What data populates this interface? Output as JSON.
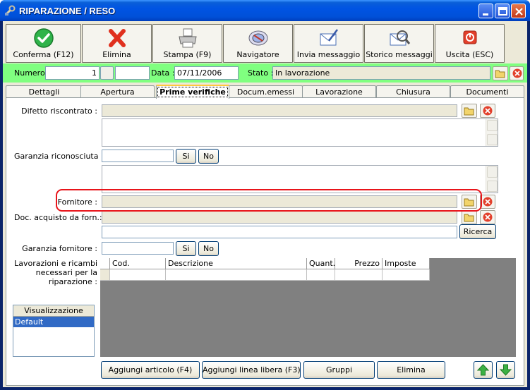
{
  "window": {
    "title": "RIPARAZIONE / RESO"
  },
  "toolbar": {
    "buttons": [
      {
        "label": "Conferma (F12)",
        "icon": "check-icon"
      },
      {
        "label": "Elimina",
        "icon": "delete-x-icon"
      },
      {
        "label": "Stampa (F9)",
        "icon": "printer-icon"
      },
      {
        "label": "Navigatore",
        "icon": "compass-icon"
      },
      {
        "label": "Invia messaggio",
        "icon": "send-mail-icon"
      },
      {
        "label": "Storico messaggi",
        "icon": "mail-history-icon"
      },
      {
        "label": "Uscita (ESC)",
        "icon": "exit-icon"
      }
    ]
  },
  "header": {
    "numero_label": "Numero :",
    "numero_value": "1",
    "data_label": "Data :",
    "data_value": "07/11/2006",
    "stato_label": "Stato :",
    "stato_value": "In lavorazione",
    "background_color": "#80ff80"
  },
  "tabs": [
    "Dettagli",
    "Apertura",
    "Prime verifiche",
    "Docum.emessi",
    "Lavorazione",
    "Chiusura",
    "Documenti"
  ],
  "active_tab": "Prime verifiche",
  "form": {
    "difetto_label": "Difetto riscontrato :",
    "garanzia_label": "Garanzia riconosciuta :",
    "si_label": "Si",
    "no_label": "No",
    "fornitore_label": "Fornitore :",
    "doc_acquisto_label": "Doc. acquisto da forn.:",
    "ricerca_label": "Ricerca",
    "garanzia_fornitore_label": "Garanzia fornitore :",
    "lavorazioni_label": "Lavorazioni e ricambi necessari per la riparazione :"
  },
  "grid": {
    "columns": [
      "Cod.",
      "Descrizione",
      "Quant.",
      "Prezzo",
      "Imposte"
    ]
  },
  "view": {
    "header": "Visualizzazione",
    "items": [
      "Default"
    ],
    "selected": "Default"
  },
  "bottom_buttons": {
    "add_article": "Aggiungi articolo (F4)",
    "add_free_line": "Aggiungi linea libera (F3)",
    "groups": "Gruppi",
    "delete": "Elimina"
  },
  "colors": {
    "highlight": "#e8141a",
    "selection": "#316ac5"
  }
}
